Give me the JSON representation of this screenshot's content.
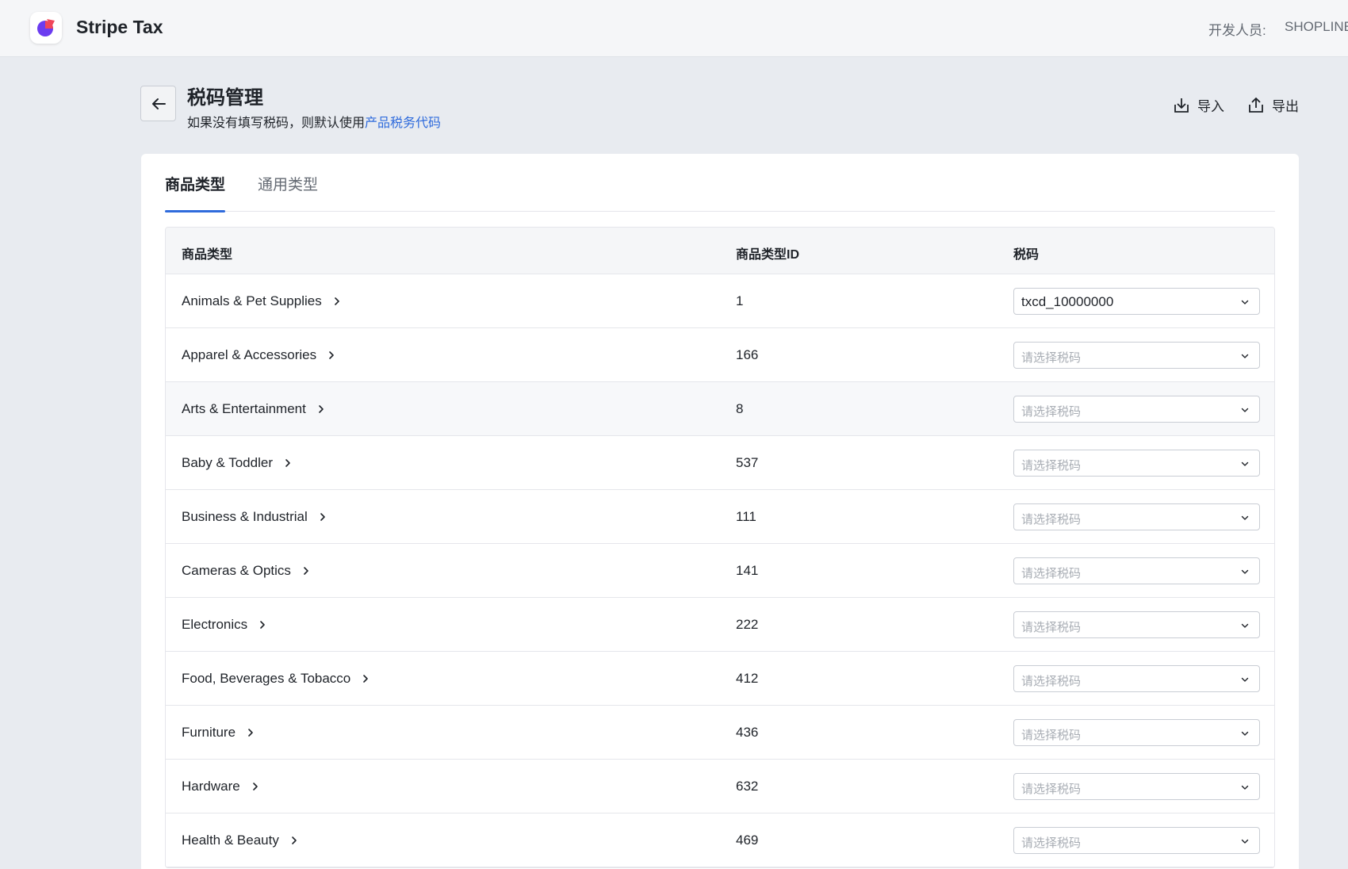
{
  "header": {
    "app_name": "Stripe Tax",
    "developer_label": "开发人员:",
    "developer_value": "SHOPLINE"
  },
  "page": {
    "title": "税码管理",
    "subtitle_prefix": "如果没有填写税码，则默认使用",
    "subtitle_link": "产品税务代码",
    "import_label": "导入",
    "export_label": "导出"
  },
  "tabs": [
    {
      "label": "商品类型",
      "active": true
    },
    {
      "label": "通用类型",
      "active": false
    }
  ],
  "table": {
    "columns": [
      "商品类型",
      "商品类型ID",
      "税码"
    ],
    "placeholder": "请选择税码",
    "rows": [
      {
        "name": "Animals & Pet Supplies",
        "id": "1",
        "tax_code": "txcd_10000000"
      },
      {
        "name": "Apparel & Accessories",
        "id": "166",
        "tax_code": ""
      },
      {
        "name": "Arts & Entertainment",
        "id": "8",
        "tax_code": ""
      },
      {
        "name": "Baby & Toddler",
        "id": "537",
        "tax_code": ""
      },
      {
        "name": "Business & Industrial",
        "id": "111",
        "tax_code": ""
      },
      {
        "name": "Cameras & Optics",
        "id": "141",
        "tax_code": ""
      },
      {
        "name": "Electronics",
        "id": "222",
        "tax_code": ""
      },
      {
        "name": "Food, Beverages & Tobacco",
        "id": "412",
        "tax_code": ""
      },
      {
        "name": "Furniture",
        "id": "436",
        "tax_code": ""
      },
      {
        "name": "Hardware",
        "id": "632",
        "tax_code": ""
      },
      {
        "name": "Health & Beauty",
        "id": "469",
        "tax_code": ""
      }
    ]
  },
  "colors": {
    "accent": "#2f6bdc",
    "logo_purple": "#6b3cf0",
    "logo_red": "#f0465a"
  }
}
